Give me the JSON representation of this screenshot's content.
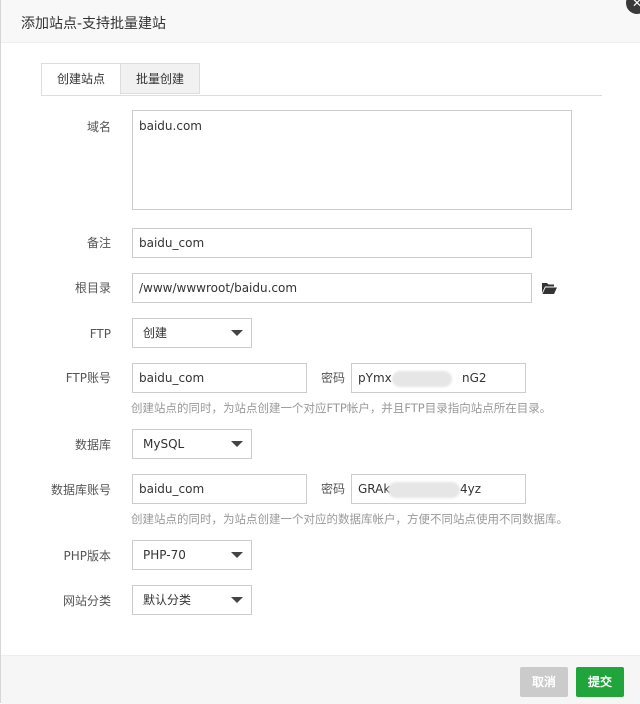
{
  "dialog": {
    "title": "添加站点-支持批量建站",
    "close_glyph": "✕"
  },
  "tabs": [
    {
      "label": "创建站点",
      "active": true
    },
    {
      "label": "批量创建",
      "active": false
    }
  ],
  "form": {
    "domain": {
      "label": "域名",
      "value": "baidu.com"
    },
    "remark": {
      "label": "备注",
      "value": "baidu_com"
    },
    "root": {
      "label": "根目录",
      "value": "/www/wwwroot/baidu.com",
      "icon": "folder-open-icon"
    },
    "ftp": {
      "label": "FTP",
      "value": "创建"
    },
    "ftp_account": {
      "label": "FTP账号",
      "username": "baidu_com",
      "password_label": "密码",
      "password_visible_start": "pYmx",
      "password_visible_end": "nG2",
      "hint": "创建站点的同时，为站点创建一个对应FTP帐户，并且FTP目录指向站点所在目录。"
    },
    "database": {
      "label": "数据库",
      "value": "MySQL"
    },
    "db_account": {
      "label": "数据库账号",
      "username": "baidu_com",
      "password_label": "密码",
      "password_visible_start": "GRAk",
      "password_visible_end": "4yz",
      "hint": "创建站点的同时，为站点创建一个对应的数据库帐户，方便不同站点使用不同数据库。"
    },
    "php": {
      "label": "PHP版本",
      "value": "PHP-70"
    },
    "category": {
      "label": "网站分类",
      "value": "默认分类"
    }
  },
  "footer": {
    "cancel_label": "取消",
    "submit_label": "提交"
  },
  "colors": {
    "primary": "#20a53a",
    "cancel": "#cbcbcb",
    "hint": "#999999"
  }
}
